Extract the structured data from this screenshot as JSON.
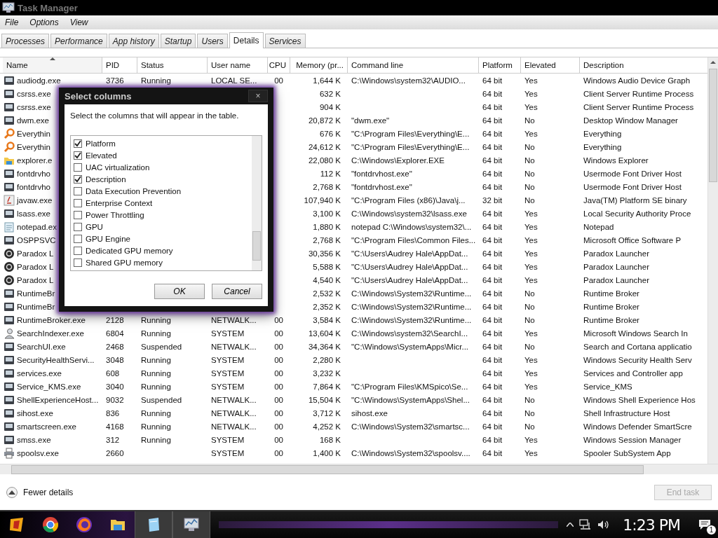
{
  "window": {
    "title": "Task Manager"
  },
  "menu": [
    "File",
    "Options",
    "View"
  ],
  "tabs": [
    {
      "label": "Processes",
      "selected": false
    },
    {
      "label": "Performance",
      "selected": false
    },
    {
      "label": "App history",
      "selected": false
    },
    {
      "label": "Startup",
      "selected": false
    },
    {
      "label": "Users",
      "selected": false
    },
    {
      "label": "Details",
      "selected": true
    },
    {
      "label": "Services",
      "selected": false
    }
  ],
  "table": {
    "columns": [
      {
        "label": "Name",
        "sorted": true
      },
      {
        "label": "PID",
        "sorted": false
      },
      {
        "label": "Status",
        "sorted": false
      },
      {
        "label": "User name",
        "sorted": false
      },
      {
        "label": "CPU",
        "sorted": false
      },
      {
        "label": "Memory (pr...",
        "sorted": false
      },
      {
        "label": "Command line",
        "sorted": false
      },
      {
        "label": "Platform",
        "sorted": false
      },
      {
        "label": "Elevated",
        "sorted": false
      },
      {
        "label": "Description",
        "sorted": false
      }
    ],
    "rows": [
      {
        "kind": "app",
        "name": "audiodg.exe",
        "pid": "3736",
        "status": "Running",
        "user": "LOCAL SE...",
        "cpu": "00",
        "memory": "1,644 K",
        "command": "C:\\Windows\\system32\\AUDIO...",
        "platform": "64 bit",
        "elevated": "Yes",
        "description": "Windows Audio Device Graph"
      },
      {
        "kind": "app",
        "name": "csrss.exe",
        "memory": "632 K",
        "platform": "64 bit",
        "elevated": "Yes",
        "description": "Client Server Runtime Process"
      },
      {
        "kind": "app",
        "name": "csrss.exe",
        "memory": "904 K",
        "platform": "64 bit",
        "elevated": "Yes",
        "description": "Client Server Runtime Process"
      },
      {
        "kind": "app",
        "name": "dwm.exe",
        "memory": "20,872 K",
        "command": "\"dwm.exe\"",
        "platform": "64 bit",
        "elevated": "No",
        "description": "Desktop Window Manager"
      },
      {
        "kind": "search",
        "name": "Everythin",
        "memory": "676 K",
        "command": "\"C:\\Program Files\\Everything\\E...",
        "platform": "64 bit",
        "elevated": "Yes",
        "description": "Everything"
      },
      {
        "kind": "search",
        "name": "Everythin",
        "memory": "24,612 K",
        "command": "\"C:\\Program Files\\Everything\\E...",
        "platform": "64 bit",
        "elevated": "No",
        "description": "Everything"
      },
      {
        "kind": "explorer",
        "name": "explorer.e",
        "memory": "22,080 K",
        "command": "C:\\Windows\\Explorer.EXE",
        "platform": "64 bit",
        "elevated": "No",
        "description": "Windows Explorer"
      },
      {
        "kind": "app",
        "name": "fontdrvho",
        "memory": "112 K",
        "command": "\"fontdrvhost.exe\"",
        "platform": "64 bit",
        "elevated": "No",
        "description": "Usermode Font Driver Host"
      },
      {
        "kind": "app",
        "name": "fontdrvho",
        "memory": "2,768 K",
        "command": "\"fontdrvhost.exe\"",
        "platform": "64 bit",
        "elevated": "No",
        "description": "Usermode Font Driver Host"
      },
      {
        "kind": "java",
        "name": "javaw.exe",
        "memory": "107,940 K",
        "command": "\"C:\\Program Files (x86)\\Java\\j...",
        "platform": "32 bit",
        "elevated": "No",
        "description": "Java(TM) Platform SE binary"
      },
      {
        "kind": "app",
        "name": "lsass.exe",
        "memory": "3,100 K",
        "command": "C:\\Windows\\system32\\lsass.exe",
        "platform": "64 bit",
        "elevated": "Yes",
        "description": "Local Security Authority Proce"
      },
      {
        "kind": "notepad",
        "name": "notepad.ex",
        "memory": "1,880 K",
        "command": "notepad C:\\Windows\\system32\\...",
        "platform": "64 bit",
        "elevated": "Yes",
        "description": "Notepad"
      },
      {
        "kind": "app",
        "name": "OSPPSVC",
        "memory": "2,768 K",
        "command": "\"C:\\Program Files\\Common Files...",
        "platform": "64 bit",
        "elevated": "Yes",
        "description": "Microsoft Office Software P"
      },
      {
        "kind": "launcher",
        "name": "Paradox L",
        "memory": "30,356 K",
        "command": "\"C:\\Users\\Audrey Hale\\AppDat...",
        "platform": "64 bit",
        "elevated": "Yes",
        "description": "Paradox Launcher"
      },
      {
        "kind": "launcher",
        "name": "Paradox L",
        "memory": "5,588 K",
        "command": "\"C:\\Users\\Audrey Hale\\AppDat...",
        "platform": "64 bit",
        "elevated": "Yes",
        "description": "Paradox Launcher"
      },
      {
        "kind": "launcher",
        "name": "Paradox L",
        "memory": "4,540 K",
        "command": "\"C:\\Users\\Audrey Hale\\AppDat...",
        "platform": "64 bit",
        "elevated": "Yes",
        "description": "Paradox Launcher"
      },
      {
        "kind": "app",
        "name": "RuntimeBr",
        "memory": "2,532 K",
        "command": "C:\\Windows\\System32\\Runtime...",
        "platform": "64 bit",
        "elevated": "No",
        "description": "Runtime Broker"
      },
      {
        "kind": "app",
        "name": "RuntimeBr",
        "memory": "2,352 K",
        "command": "C:\\Windows\\System32\\Runtime...",
        "platform": "64 bit",
        "elevated": "No",
        "description": "Runtime Broker"
      },
      {
        "kind": "app",
        "name": "RuntimeBroker.exe",
        "pid": "2128",
        "status": "Running",
        "user": "NETWALK...",
        "cpu": "00",
        "memory": "3,584 K",
        "command": "C:\\Windows\\System32\\Runtime...",
        "platform": "64 bit",
        "elevated": "No",
        "description": "Runtime Broker"
      },
      {
        "kind": "indexer",
        "name": "SearchIndexer.exe",
        "pid": "6804",
        "status": "Running",
        "user": "SYSTEM",
        "cpu": "00",
        "memory": "13,604 K",
        "command": "C:\\Windows\\system32\\SearchI...",
        "platform": "64 bit",
        "elevated": "Yes",
        "description": "Microsoft Windows Search In"
      },
      {
        "kind": "app",
        "name": "SearchUI.exe",
        "pid": "2468",
        "status": "Suspended",
        "user": "NETWALK...",
        "cpu": "00",
        "memory": "34,364 K",
        "command": "\"C:\\Windows\\SystemApps\\Micr...",
        "platform": "64 bit",
        "elevated": "No",
        "description": "Search and Cortana applicatio"
      },
      {
        "kind": "app",
        "name": "SecurityHealthServi...",
        "pid": "3048",
        "status": "Running",
        "user": "SYSTEM",
        "cpu": "00",
        "memory": "2,280 K",
        "platform": "64 bit",
        "elevated": "Yes",
        "description": "Windows Security Health Serv"
      },
      {
        "kind": "app",
        "name": "services.exe",
        "pid": "608",
        "status": "Running",
        "user": "SYSTEM",
        "cpu": "00",
        "memory": "3,232 K",
        "platform": "64 bit",
        "elevated": "Yes",
        "description": "Services and Controller app"
      },
      {
        "kind": "app",
        "name": "Service_KMS.exe",
        "pid": "3040",
        "status": "Running",
        "user": "SYSTEM",
        "cpu": "00",
        "memory": "7,864 K",
        "command": "\"C:\\Program Files\\KMSpico\\Se...",
        "platform": "64 bit",
        "elevated": "Yes",
        "description": "Service_KMS"
      },
      {
        "kind": "app",
        "name": "ShellExperienceHost...",
        "pid": "9032",
        "status": "Suspended",
        "user": "NETWALK...",
        "cpu": "00",
        "memory": "15,504 K",
        "command": "\"C:\\Windows\\SystemApps\\Shel...",
        "platform": "64 bit",
        "elevated": "No",
        "description": "Windows Shell Experience Hos"
      },
      {
        "kind": "app",
        "name": "sihost.exe",
        "pid": "836",
        "status": "Running",
        "user": "NETWALK...",
        "cpu": "00",
        "memory": "3,712 K",
        "command": "sihost.exe",
        "platform": "64 bit",
        "elevated": "No",
        "description": "Shell Infrastructure Host"
      },
      {
        "kind": "app",
        "name": "smartscreen.exe",
        "pid": "4168",
        "status": "Running",
        "user": "NETWALK...",
        "cpu": "00",
        "memory": "4,252 K",
        "command": "C:\\Windows\\System32\\smartsc...",
        "platform": "64 bit",
        "elevated": "No",
        "description": "Windows Defender SmartScre"
      },
      {
        "kind": "app",
        "name": "smss.exe",
        "pid": "312",
        "status": "Running",
        "user": "SYSTEM",
        "cpu": "00",
        "memory": "168 K",
        "platform": "64 bit",
        "elevated": "Yes",
        "description": "Windows Session Manager"
      },
      {
        "kind": "spooler",
        "name": "spoolsv.exe",
        "pid": "2660",
        "user": "SYSTEM",
        "cpu": "00",
        "memory": "1,400 K",
        "command": "C:\\Windows\\System32\\spoolsv....",
        "platform": "64 bit",
        "elevated": "Yes",
        "description": "Spooler SubSystem App"
      }
    ]
  },
  "dialog": {
    "title": "Select columns",
    "close": "×",
    "prompt": "Select the columns that will appear in the table.",
    "options": [
      {
        "label": "Platform",
        "checked": true
      },
      {
        "label": "Elevated",
        "checked": true
      },
      {
        "label": "UAC virtualization",
        "checked": false
      },
      {
        "label": "Description",
        "checked": true
      },
      {
        "label": "Data Execution Prevention",
        "checked": false
      },
      {
        "label": "Enterprise Context",
        "checked": false
      },
      {
        "label": "Power Throttling",
        "checked": false
      },
      {
        "label": "GPU",
        "checked": false
      },
      {
        "label": "GPU Engine",
        "checked": false
      },
      {
        "label": "Dedicated GPU memory",
        "checked": false
      },
      {
        "label": "Shared GPU memory",
        "checked": false
      }
    ],
    "buttons": [
      "OK",
      "Cancel"
    ]
  },
  "footer": {
    "toggle": "Fewer details",
    "end_task": {
      "label": "End task",
      "disabled": true
    }
  },
  "taskbar": {
    "apps": [
      {
        "kind": "start"
      },
      {
        "kind": "browser-round"
      },
      {
        "kind": "fox"
      },
      {
        "kind": "folder"
      },
      {
        "kind": "note",
        "selected": true
      },
      {
        "kind": "monitor",
        "selected": true
      }
    ],
    "clock": "1:23 PM",
    "notifications": "1"
  }
}
